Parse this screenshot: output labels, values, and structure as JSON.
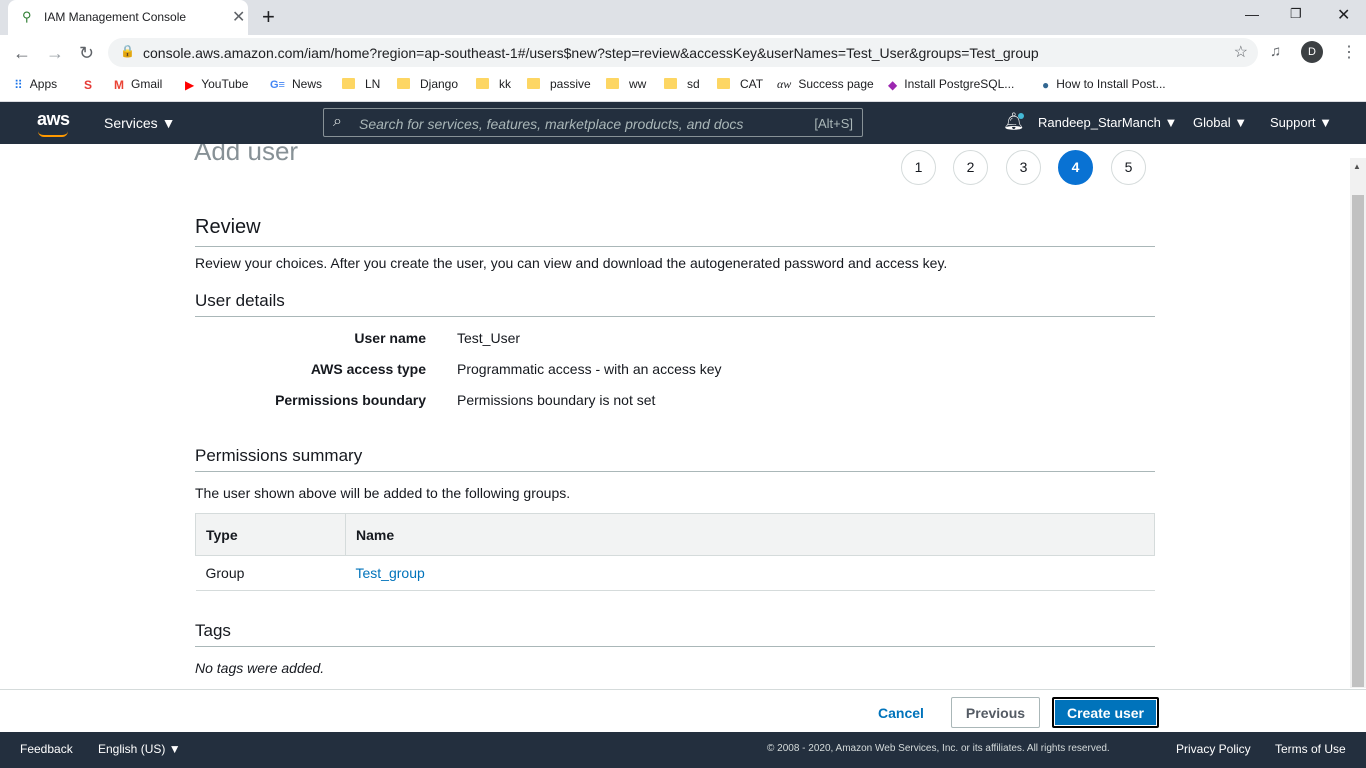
{
  "browser": {
    "tab_title": "IAM Management Console",
    "tab_close": "✕",
    "new_tab": "+",
    "url": "console.aws.amazon.com/iam/home?region=ap-southeast-1#/users$new?step=review&accessKey&userNames=Test_User&groups=Test_group",
    "profile_initial": "D",
    "bookmarks": [
      "Apps",
      "Gmail",
      "YouTube",
      "News",
      "LN",
      "Django",
      "kk",
      "passive",
      "ww",
      "sd",
      "CAT",
      "Success page",
      "Install PostgreSQL...",
      "How to Install Post..."
    ]
  },
  "aws_nav": {
    "logo": "aws",
    "services": "Services ▼",
    "search_placeholder": "Search for services, features, marketplace products, and docs",
    "search_hint": "[Alt+S]",
    "account": "Randeep_StarManch ▼",
    "region": "Global ▼",
    "support": "Support ▼"
  },
  "wizard": {
    "heading": "Add user",
    "steps": [
      "1",
      "2",
      "3",
      "4",
      "5"
    ],
    "active_step": 4
  },
  "review": {
    "title": "Review",
    "description": "Review your choices. After you create the user, you can view and download the autogenerated password and access key."
  },
  "user_details": {
    "title": "User details",
    "rows": [
      {
        "label": "User name",
        "value": "Test_User"
      },
      {
        "label": "AWS access type",
        "value": "Programmatic access - with an access key"
      },
      {
        "label": "Permissions boundary",
        "value": "Permissions boundary is not set"
      }
    ]
  },
  "permissions": {
    "title": "Permissions summary",
    "description": "The user shown above will be added to the following groups.",
    "columns": [
      "Type",
      "Name"
    ],
    "rows": [
      {
        "type": "Group",
        "name": "Test_group"
      }
    ]
  },
  "tags": {
    "title": "Tags",
    "empty": "No tags were added."
  },
  "actions": {
    "cancel": "Cancel",
    "previous": "Previous",
    "create": "Create user"
  },
  "footer": {
    "feedback": "Feedback",
    "language": "English (US) ▼",
    "copyright": "© 2008 - 2020, Amazon Web Services, Inc. or its affiliates. All rights reserved.",
    "privacy": "Privacy Policy",
    "terms": "Terms of Use"
  },
  "colors": {
    "aws_nav": "#232f3e",
    "link": "#0073bb",
    "primary_button": "#0073bb",
    "active_step": "#0972d3"
  }
}
